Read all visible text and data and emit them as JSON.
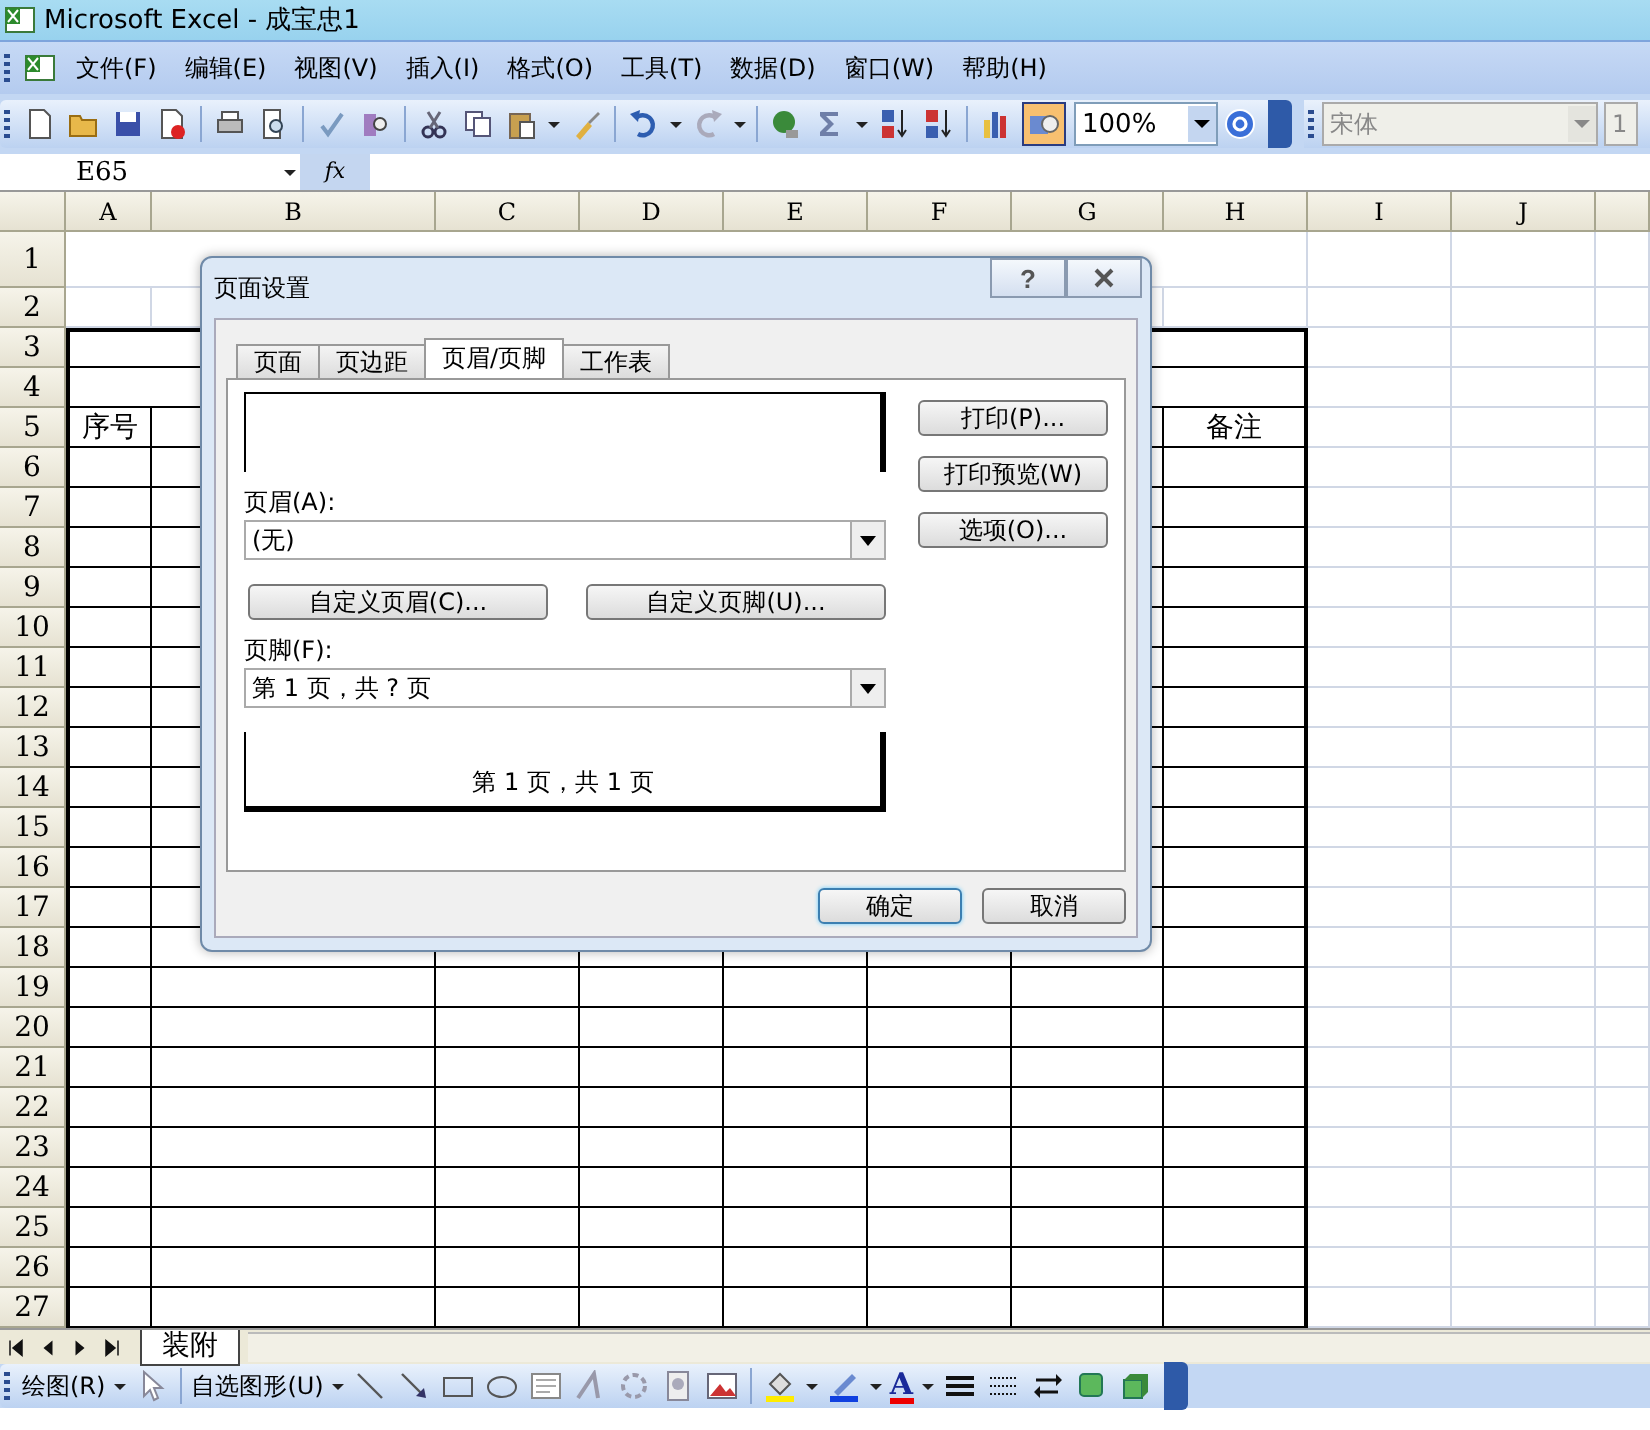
{
  "window": {
    "title": "Microsoft Excel - 成宝忠1"
  },
  "menu": [
    "文件(F)",
    "编辑(E)",
    "视图(V)",
    "插入(I)",
    "格式(O)",
    "工具(T)",
    "数据(D)",
    "窗口(W)",
    "帮助(H)"
  ],
  "toolbar": {
    "zoom": "100%",
    "font": "宋体",
    "font_size": "1"
  },
  "formula_bar": {
    "name_box": "E65",
    "fx_label": "fx"
  },
  "sheet": {
    "columns": [
      "A",
      "B",
      "C",
      "D",
      "E",
      "F",
      "G",
      "H",
      "I",
      "J"
    ],
    "rows": [
      "1",
      "2",
      "3",
      "4",
      "5",
      "6",
      "7",
      "8",
      "9",
      "10",
      "11",
      "12",
      "13",
      "14",
      "15",
      "16",
      "17",
      "18",
      "19",
      "20",
      "21",
      "22",
      "23",
      "24",
      "25",
      "26",
      "27"
    ],
    "heading_row": {
      "first_column": "序号",
      "last_column": "备注"
    }
  },
  "sheet_tabs": [
    {
      "label": "装附",
      "selected": true
    }
  ],
  "drawing_toolbar": {
    "draw_menu": "绘图(R)",
    "autoshapes_menu": "自选图形(U)",
    "font_color_label": "A"
  },
  "dialog": {
    "title": "页面设置",
    "help": "?",
    "tabs": [
      {
        "label": "页面",
        "selected": false
      },
      {
        "label": "页边距",
        "selected": false
      },
      {
        "label": "页眉/页脚",
        "selected": true
      },
      {
        "label": "工作表",
        "selected": false
      }
    ],
    "header_label": "页眉(A):",
    "header_value": "(无)",
    "custom_header": "自定义页眉(C)...",
    "custom_footer": "自定义页脚(U)...",
    "footer_label": "页脚(F):",
    "footer_value": "第 1 页，共 ? 页",
    "footer_preview": "第 1 页，共 1 页",
    "side_buttons": [
      "打印(P)...",
      "打印预览(W)",
      "选项(O)..."
    ],
    "ok": "确定",
    "cancel": "取消"
  }
}
